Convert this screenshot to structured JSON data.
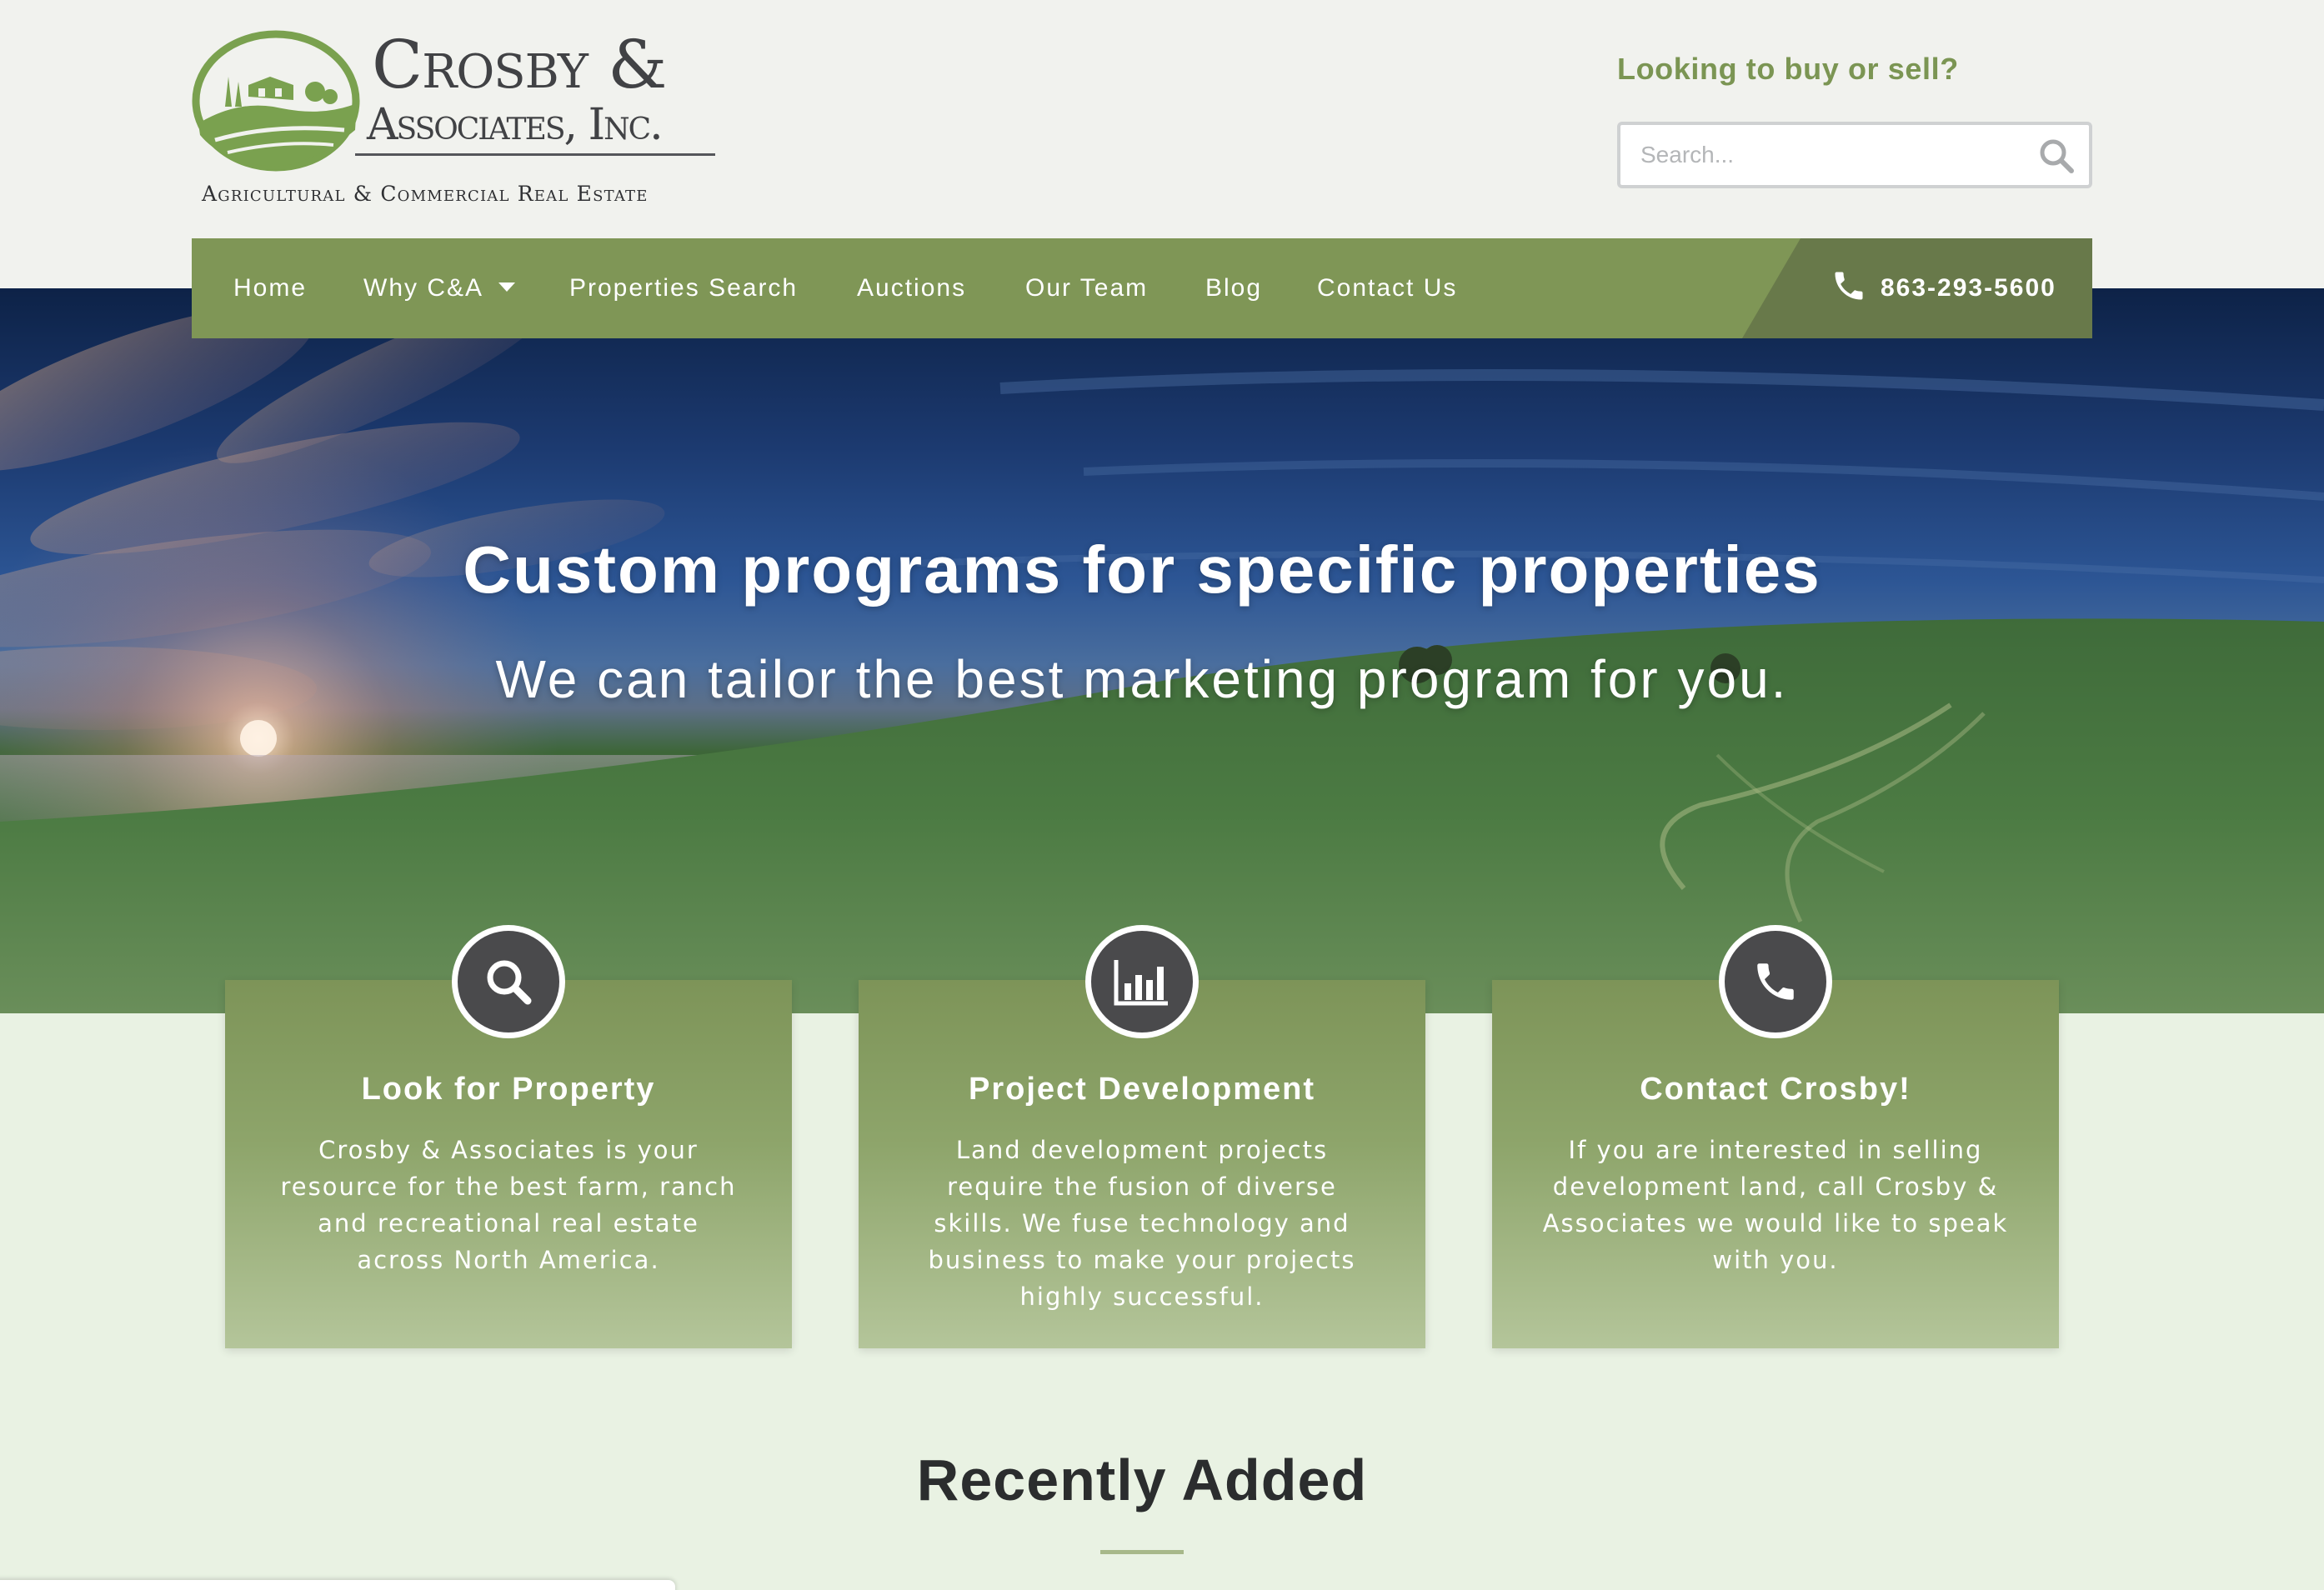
{
  "brand": {
    "name_line1": "Crosby &",
    "name_line2": "Associates, Inc.",
    "tagline": "Agricultural & Commercial Real Estate",
    "primary_color": "#7f9656",
    "dark_color": "#68794a"
  },
  "header": {
    "prompt": "Looking to buy or sell?",
    "search": {
      "placeholder": "Search..."
    }
  },
  "nav": {
    "items": [
      {
        "label": "Home"
      },
      {
        "label": "Why C&A",
        "has_dropdown": true
      },
      {
        "label": "Properties Search"
      },
      {
        "label": "Auctions"
      },
      {
        "label": "Our Team"
      },
      {
        "label": "Blog"
      },
      {
        "label": "Contact Us"
      }
    ],
    "phone": "863-293-5600"
  },
  "hero": {
    "title": "Custom programs for specific properties",
    "subtitle": "We can tailor the best marketing program for you."
  },
  "features": [
    {
      "icon": "search-icon",
      "title": "Look for Property",
      "text": "Crosby & Associates is your resource for the best farm, ranch and recreational real estate across North America."
    },
    {
      "icon": "chart-icon",
      "title": "Project Development",
      "text": "Land development projects require the fusion of diverse skills. We fuse technology and business to make your projects highly successful."
    },
    {
      "icon": "phone-icon",
      "title": "Contact Crosby!",
      "text": "If you are interested in selling development land, call Crosby & Associates we would like to speak with you."
    }
  ],
  "recent": {
    "title": "Recently Added"
  }
}
